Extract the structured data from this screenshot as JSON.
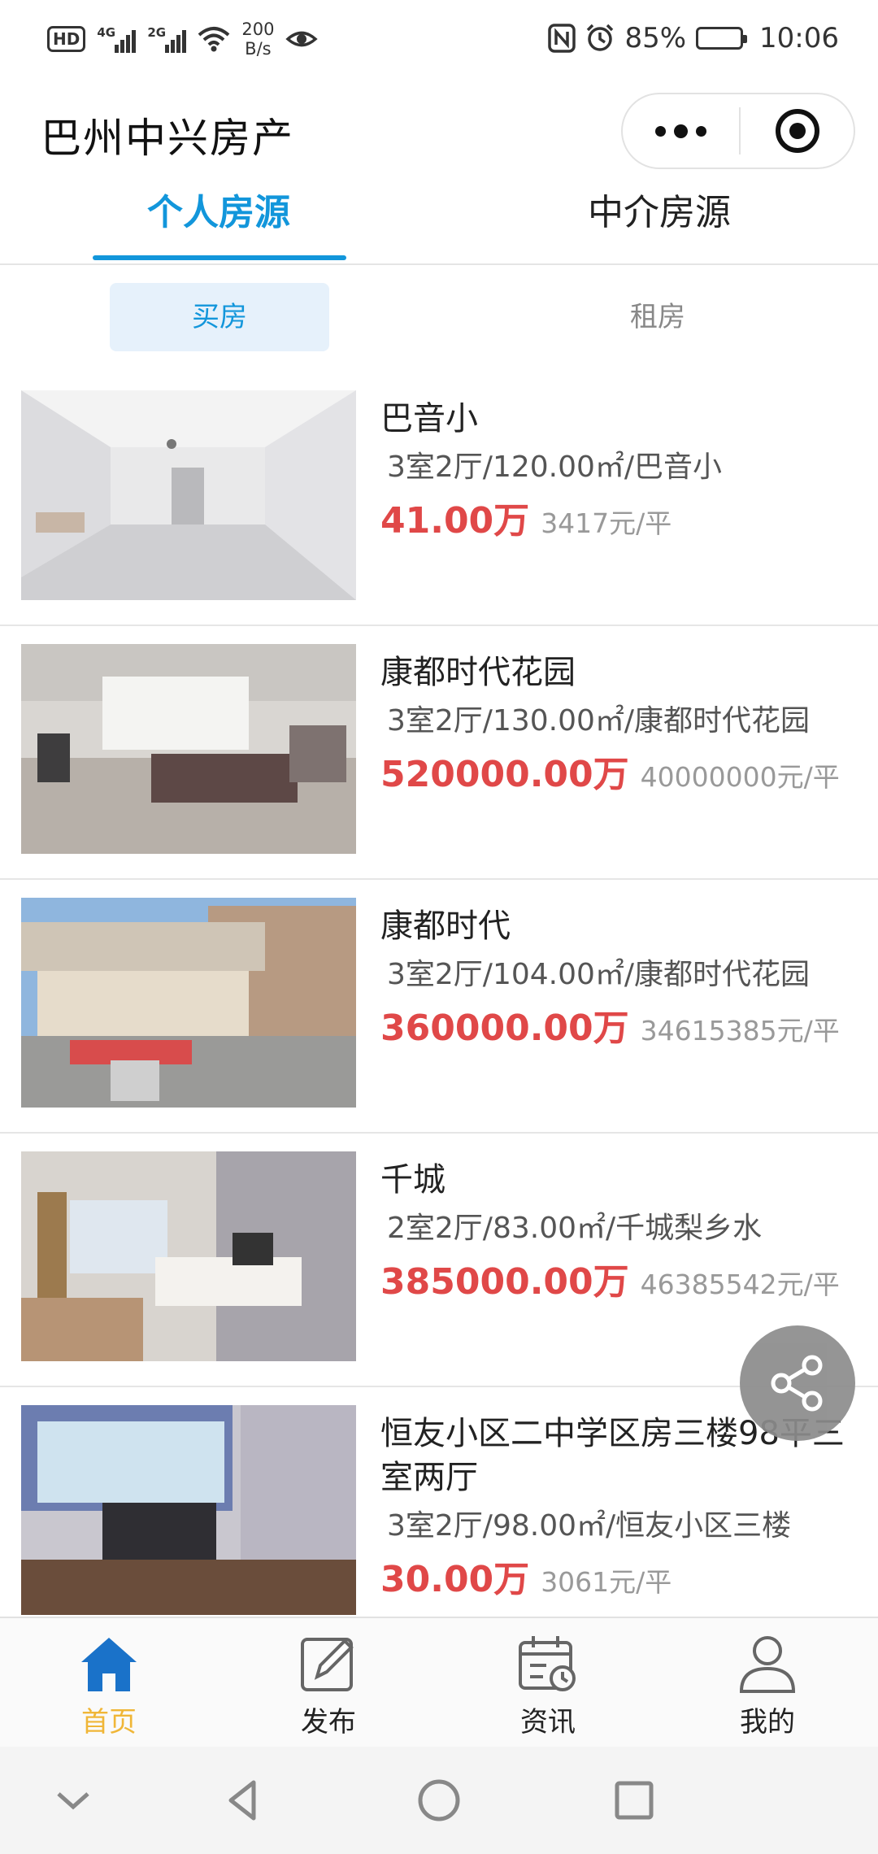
{
  "status_bar": {
    "hd": "HD",
    "net1": "4G",
    "net2": "2G",
    "speed_value": "200",
    "speed_unit": "B/s",
    "battery": "85%",
    "time": "10:06"
  },
  "header": {
    "title": "巴州中兴房产"
  },
  "tabs": [
    {
      "label": "个人房源",
      "active": true
    },
    {
      "label": "中介房源",
      "active": false
    }
  ],
  "subtabs": [
    {
      "label": "买房",
      "active": true
    },
    {
      "label": "租房",
      "active": false
    }
  ],
  "listings": [
    {
      "title": "巴音小",
      "desc": "3室2厅/120.00㎡/巴音小",
      "price": "41.00万",
      "unit_price": "3417元/平"
    },
    {
      "title": "康都时代花园",
      "desc": "3室2厅/130.00㎡/康都时代花园",
      "price": "520000.00万",
      "unit_price": "40000000元/平"
    },
    {
      "title": "康都时代",
      "desc": "3室2厅/104.00㎡/康都时代花园",
      "price": "360000.00万",
      "unit_price": "34615385元/平"
    },
    {
      "title": "千城",
      "desc": "2室2厅/83.00㎡/千城梨乡水",
      "price": "385000.00万",
      "unit_price": "46385542元/平"
    },
    {
      "title": "恒友小区二中学区房三楼98平三室两厅",
      "desc": "3室2厅/98.00㎡/恒友小区三楼",
      "price": "30.00万",
      "unit_price": "3061元/平"
    }
  ],
  "bottom_nav": [
    {
      "label": "首页",
      "icon": "home-icon",
      "active": true
    },
    {
      "label": "发布",
      "icon": "edit-icon",
      "active": false
    },
    {
      "label": "资讯",
      "icon": "calendar-icon",
      "active": false
    },
    {
      "label": "我的",
      "icon": "user-icon",
      "active": false
    }
  ],
  "colors": {
    "accent": "#1296db",
    "price": "#e04848",
    "nav_active": "#f0b637"
  }
}
